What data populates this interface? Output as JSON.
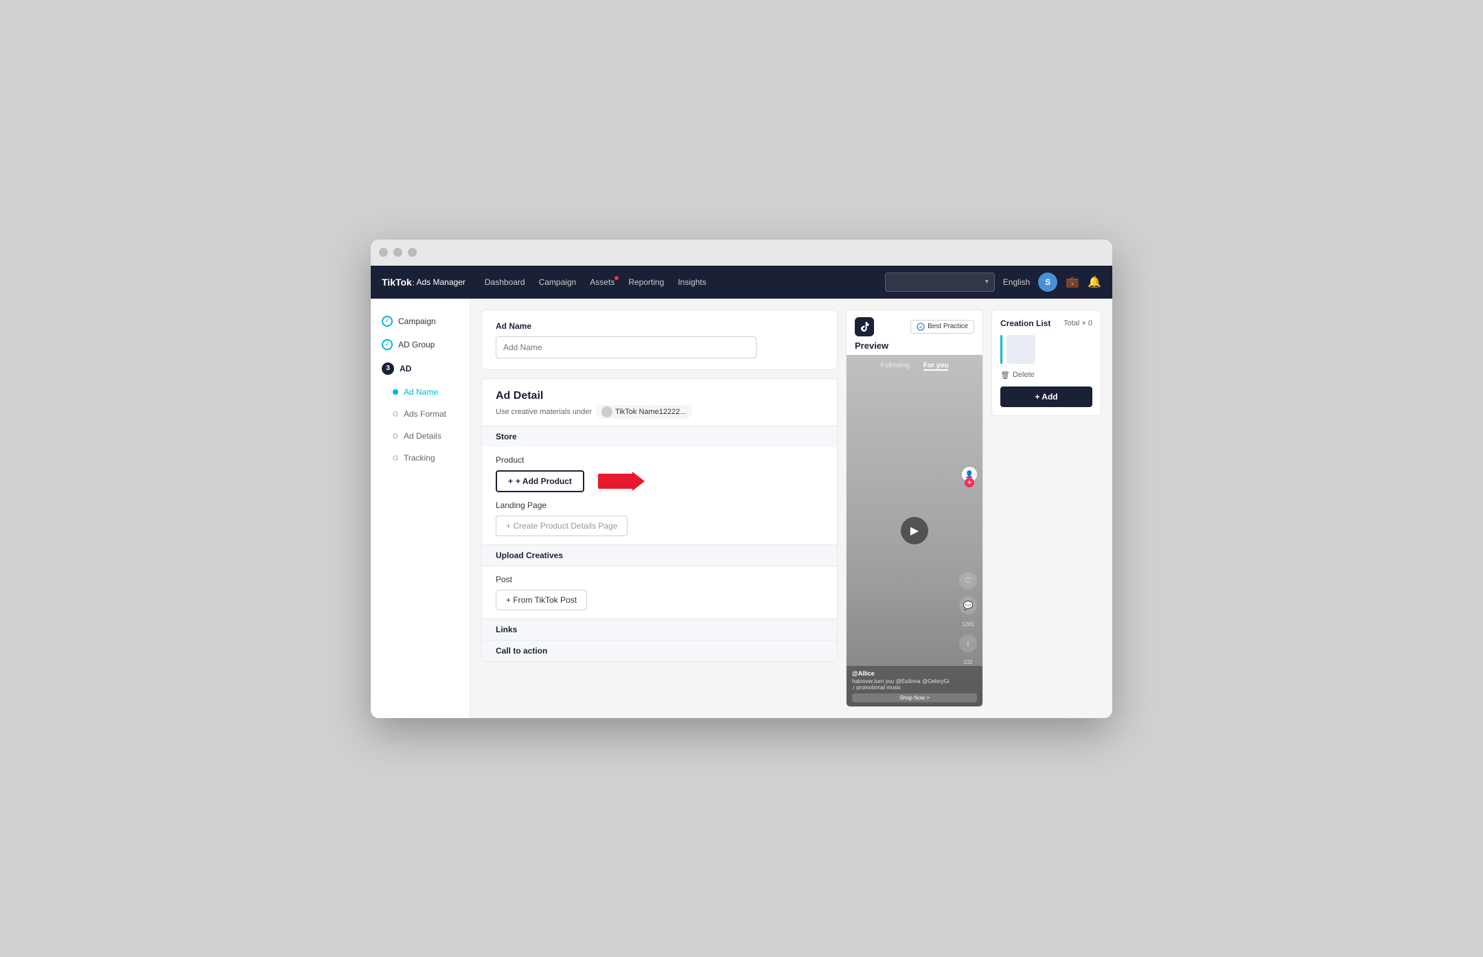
{
  "window": {
    "title": "TikTok Ads Manager"
  },
  "nav": {
    "brand": "TikTok",
    "brand_colon": ":",
    "brand_sub": "Ads Manager",
    "links": [
      "Dashboard",
      "Campaign",
      "Assets",
      "Reporting",
      "Insights"
    ],
    "assets_dot": true,
    "lang": "English",
    "avatar_letter": "S"
  },
  "sidebar": {
    "items": [
      {
        "id": "campaign",
        "label": "Campaign",
        "type": "check"
      },
      {
        "id": "ad-group",
        "label": "AD Group",
        "type": "check"
      },
      {
        "id": "ad",
        "label": "AD",
        "type": "number",
        "number": "3"
      },
      {
        "id": "ad-name",
        "label": "Ad Name",
        "type": "dot-active"
      },
      {
        "id": "ads-format",
        "label": "Ads Format",
        "type": "dot-empty"
      },
      {
        "id": "ad-details",
        "label": "Ad Details",
        "type": "dot-empty"
      },
      {
        "id": "tracking",
        "label": "Tracking",
        "type": "dot-empty"
      }
    ]
  },
  "ad_name_section": {
    "label": "Ad Name",
    "placeholder": "Add Name"
  },
  "ad_detail": {
    "title": "Ad Detail",
    "subtitle": "Use creative materials under",
    "account": "TikTok Name12222..."
  },
  "sections": {
    "store": "Store",
    "product_label": "Product",
    "add_product": "+ Add Product",
    "landing_page_label": "Landing Page",
    "create_page": "+ Create Product Details Page",
    "upload_creatives": "Upload Creatives",
    "post_label": "Post",
    "from_tiktok": "+ From TikTok Post",
    "links": "Links",
    "call_to_action": "Call to action"
  },
  "preview": {
    "title": "Preview",
    "best_practice": "Best Practice",
    "tabs": [
      "Following",
      "For you"
    ],
    "active_tab": "For you",
    "username": "@Allice",
    "caption": "haloover.turn you @Esilinna @GeleryGi",
    "music": "♪ promotional music",
    "shop_now": "Shop Now >"
  },
  "creation_list": {
    "title": "Creation List",
    "total_label": "Total",
    "total_value": "× 0",
    "delete_label": "Delete",
    "add_label": "+ Add"
  }
}
